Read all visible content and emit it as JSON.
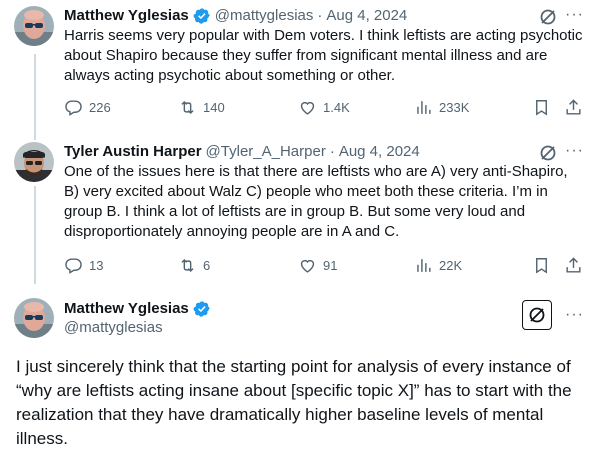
{
  "tweets": [
    {
      "name": "Matthew Yglesias",
      "handle": "@mattyglesias",
      "date": "Aug 4, 2024",
      "text": "Harris seems very popular with Dem voters. I think leftists are acting psychotic about Shapiro because they suffer from significant mental illness and are always acting psychotic about something or other.",
      "replies": "226",
      "retweets": "140",
      "likes": "1.4K",
      "views": "233K"
    },
    {
      "name": "Tyler Austin Harper",
      "handle": "@Tyler_A_Harper",
      "date": "Aug 4, 2024",
      "text": "One of the issues here is that there are leftists who are A) very anti-Shapiro, B) very excited about Walz C) people who meet both these criteria. I’m in group B. I think a lot of leftists are in group B. But some very loud and disproportionately annoying people are in A and C.",
      "replies": "13",
      "retweets": "6",
      "likes": "91",
      "views": "22K"
    }
  ],
  "main_tweet": {
    "name": "Matthew Yglesias",
    "handle": "@mattyglesias",
    "text": "I just sincerely think that the starting point for analysis of every instance of “why are leftists acting insane about [specific topic X]” has to start with the realization that they have dramatically higher baseline levels of mental illness."
  },
  "dot_separator": "·",
  "more_glyph": "···",
  "colors": {
    "verified": "#1d9bf0",
    "muted": "#536471",
    "thread_line": "#cfd9de"
  },
  "icons": [
    "reply-icon",
    "retweet-icon",
    "like-icon",
    "views-icon",
    "bookmark-icon",
    "share-icon",
    "grok-icon",
    "verified-badge-icon",
    "more-icon"
  ]
}
